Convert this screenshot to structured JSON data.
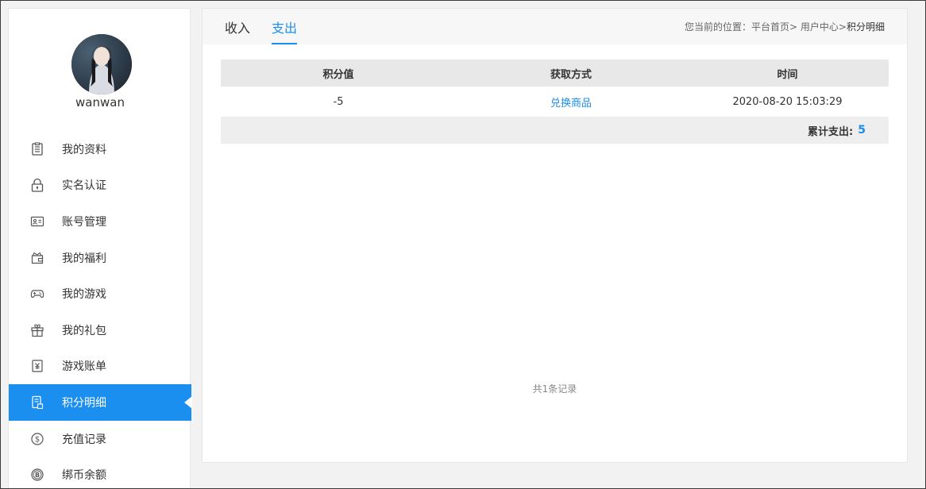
{
  "user": {
    "name": "wanwan"
  },
  "menu": {
    "items": [
      {
        "label": "我的资料",
        "icon": "profile-icon"
      },
      {
        "label": "实名认证",
        "icon": "lock-icon"
      },
      {
        "label": "账号管理",
        "icon": "id-card-icon"
      },
      {
        "label": "我的福利",
        "icon": "wallet-icon"
      },
      {
        "label": "我的游戏",
        "icon": "gamepad-icon"
      },
      {
        "label": "我的礼包",
        "icon": "gift-icon"
      },
      {
        "label": "游戏账单",
        "icon": "bill-icon"
      },
      {
        "label": "积分明细",
        "icon": "points-icon",
        "active": true
      },
      {
        "label": "充值记录",
        "icon": "dollar-coin-icon"
      },
      {
        "label": "绑币余额",
        "icon": "b-coin-icon"
      }
    ]
  },
  "tabs": {
    "income": "收入",
    "expense": "支出",
    "active": "expense"
  },
  "breadcrumb": {
    "prefix": "您当前的位置：",
    "home": "平台首页",
    "sep1": ">",
    "center": "用户中心",
    "sep2": ">",
    "current": "积分明细"
  },
  "table": {
    "headers": [
      "积分值",
      "获取方式",
      "时间"
    ],
    "rows": [
      {
        "points": "-5",
        "method": "兑换商品",
        "time": "2020-08-20 15:03:29"
      }
    ],
    "total_label": "累计支出:",
    "total_value": "5"
  },
  "footer": {
    "records": "共1条记录"
  },
  "colors": {
    "accent": "#1a8ff0"
  }
}
